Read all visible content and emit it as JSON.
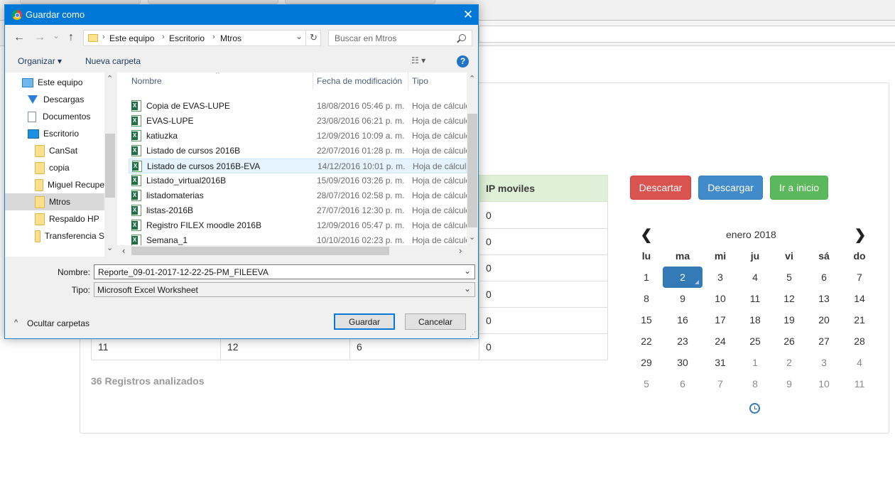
{
  "page": {
    "table": {
      "column_header": "IP moviles",
      "ip_values": [
        "0",
        "0",
        "0",
        "0",
        "0",
        "0"
      ],
      "last_row": [
        "11",
        "12",
        "6",
        "0"
      ]
    },
    "registros": "36 Registros analizados",
    "buttons": {
      "descartar": "Descartar",
      "descargar": "Descargar",
      "ir_inicio": "Ir a inicio"
    },
    "calendar": {
      "title": "enero 2018",
      "prev": "❮",
      "next": "❯",
      "weekdays": [
        "lu",
        "ma",
        "mi",
        "ju",
        "vi",
        "sá",
        "do"
      ],
      "weeks": [
        [
          "1",
          "2",
          "3",
          "4",
          "5",
          "6",
          "7"
        ],
        [
          "8",
          "9",
          "10",
          "11",
          "12",
          "13",
          "14"
        ],
        [
          "15",
          "16",
          "17",
          "18",
          "19",
          "20",
          "21"
        ],
        [
          "22",
          "23",
          "24",
          "25",
          "26",
          "27",
          "28"
        ],
        [
          "29",
          "30",
          "31",
          "1",
          "2",
          "3",
          "4"
        ],
        [
          "5",
          "6",
          "7",
          "8",
          "9",
          "10",
          "11"
        ]
      ],
      "selected_day": "2"
    }
  },
  "dialog": {
    "title": "Guardar como",
    "close": "✕",
    "nav": {
      "back": "←",
      "forward": "→",
      "recent": "⌄",
      "up": "↑"
    },
    "address": {
      "crumbs": [
        "Este equipo",
        "Escritorio",
        "Mtros"
      ],
      "sep": "›",
      "dropdown": "⌄",
      "refresh": "↻"
    },
    "search_placeholder": "Buscar en Mtros",
    "toolbar": {
      "organize": "Organizar ▾",
      "new_folder": "Nueva carpeta",
      "view": "☷ ▾",
      "help": "?"
    },
    "tree": [
      {
        "label": "Este equipo",
        "icon": "computer-icon"
      },
      {
        "label": "Descargas",
        "icon": "download-icon"
      },
      {
        "label": "Documentos",
        "icon": "document-icon"
      },
      {
        "label": "Escritorio",
        "icon": "desktop-icon"
      },
      {
        "label": "CanSat",
        "icon": "folder-icon"
      },
      {
        "label": "copia",
        "icon": "folder-icon"
      },
      {
        "label": "Miguel Recupe",
        "icon": "folder-icon"
      },
      {
        "label": "Mtros",
        "icon": "folder-icon"
      },
      {
        "label": "Respaldo HP",
        "icon": "folder-icon"
      },
      {
        "label": "Transferencia S",
        "icon": "folder-icon"
      }
    ],
    "columns": {
      "name": "Nombre",
      "date": "Fecha de modificación",
      "type": "Tipo"
    },
    "files": [
      {
        "name": "Copia de EVAS-LUPE",
        "date": "18/08/2016 05:46 p. m.",
        "type": "Hoja de cálculo"
      },
      {
        "name": "EVAS-LUPE",
        "date": "23/08/2016 06:21 p. m.",
        "type": "Hoja de cálculo"
      },
      {
        "name": "katiuzka",
        "date": "12/09/2016 10:09 a. m.",
        "type": "Hoja de cálculo"
      },
      {
        "name": "Listado de cursos 2016B",
        "date": "22/07/2016 01:28 p. m.",
        "type": "Hoja de cálculo"
      },
      {
        "name": "Listado de cursos 2016B-EVA",
        "date": "14/12/2016 10:01 p. m.",
        "type": "Hoja de cálculo"
      },
      {
        "name": "Listado_virtual2016B",
        "date": "15/09/2016 03:26 p. m.",
        "type": "Hoja de cálculo"
      },
      {
        "name": "listadomaterias",
        "date": "28/07/2016 02:58 p. m.",
        "type": "Hoja de cálculo"
      },
      {
        "name": "listas-2016B",
        "date": "27/07/2016 12:30 p. m.",
        "type": "Hoja de cálculo"
      },
      {
        "name": "Registro FILEX moodle 2016B",
        "date": "12/09/2016 05:47 p. m.",
        "type": "Hoja de cálculo"
      },
      {
        "name": "Semana_1",
        "date": "10/10/2016 02:23 p. m.",
        "type": "Hoja de cálculo"
      }
    ],
    "selected_file": "Listado de cursos 2016B-EVA",
    "name_label": "Nombre:",
    "name_value": "Reporte_09-01-2017-12-22-25-PM_FILEEVA",
    "type_label": "Tipo:",
    "type_value": "Microsoft Excel Worksheet",
    "hide_folders": "Ocultar carpetas",
    "save": "Guardar",
    "cancel": "Cancelar",
    "scroll": {
      "up": "⌃",
      "down": "⌄",
      "left": "‹",
      "right": "›"
    }
  }
}
